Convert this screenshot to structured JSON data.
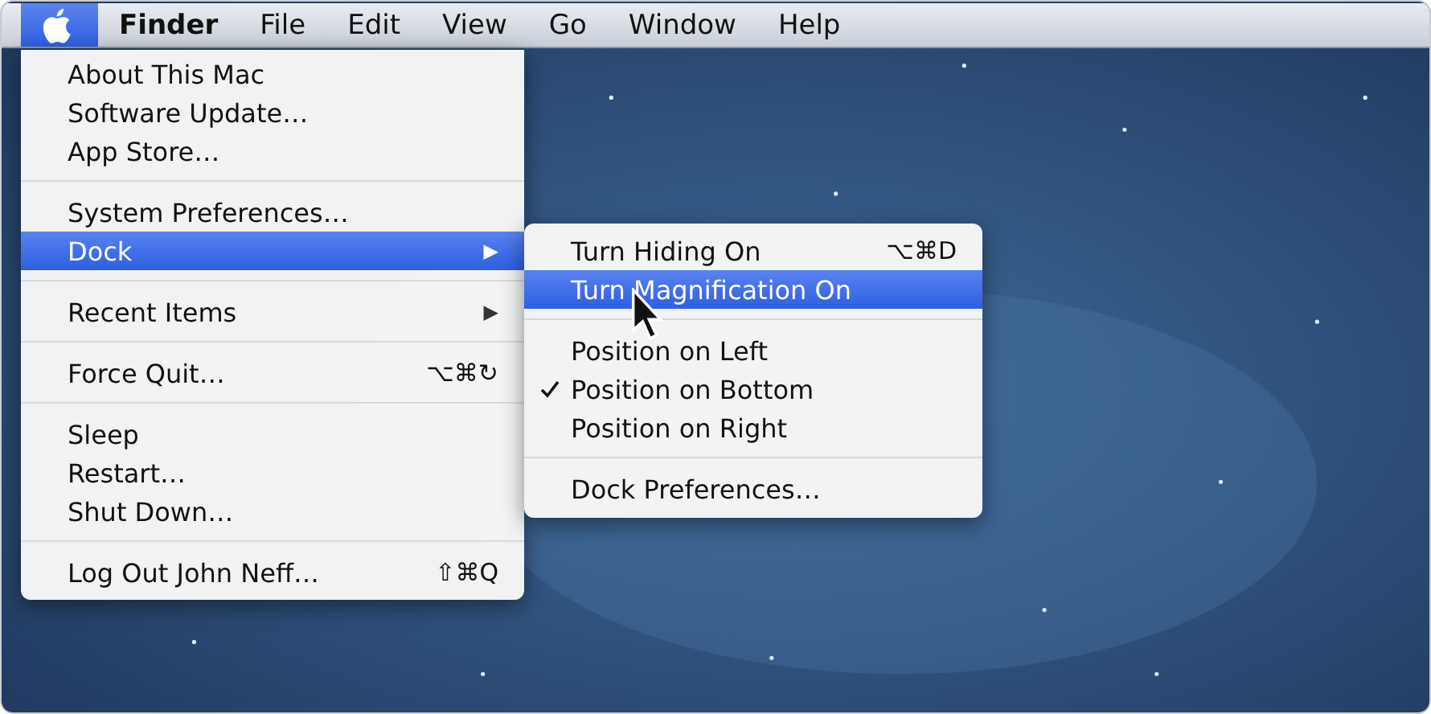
{
  "menu_bar": {
    "items": [
      {
        "kind": "apple",
        "selected": true
      },
      {
        "kind": "app",
        "label": "Finder",
        "selected": false
      },
      {
        "kind": "menu",
        "label": "File",
        "selected": false
      },
      {
        "kind": "menu",
        "label": "Edit",
        "selected": false
      },
      {
        "kind": "menu",
        "label": "View",
        "selected": false
      },
      {
        "kind": "menu",
        "label": "Go",
        "selected": false
      },
      {
        "kind": "menu",
        "label": "Window",
        "selected": false
      },
      {
        "kind": "menu",
        "label": "Help",
        "selected": false
      }
    ]
  },
  "apple_menu": {
    "items": [
      {
        "kind": "item",
        "label": "About This Mac",
        "selected": false
      },
      {
        "kind": "item",
        "label": "Software Update…",
        "selected": false
      },
      {
        "kind": "item",
        "label": "App Store…",
        "selected": false
      },
      {
        "kind": "separator"
      },
      {
        "kind": "item",
        "label": "System Preferences…",
        "selected": false
      },
      {
        "kind": "submenu",
        "label": "Dock",
        "arrow": "▶",
        "selected": true
      },
      {
        "kind": "separator"
      },
      {
        "kind": "submenu",
        "label": "Recent Items",
        "arrow": "▶",
        "selected": false
      },
      {
        "kind": "separator"
      },
      {
        "kind": "item",
        "label": "Force Quit…",
        "shortcut": "⌥⌘↻",
        "selected": false
      },
      {
        "kind": "separator"
      },
      {
        "kind": "item",
        "label": "Sleep",
        "selected": false
      },
      {
        "kind": "item",
        "label": "Restart…",
        "selected": false
      },
      {
        "kind": "item",
        "label": "Shut Down…",
        "selected": false
      },
      {
        "kind": "separator"
      },
      {
        "kind": "item",
        "label": "Log Out John Neff…",
        "shortcut": "⇧⌘Q",
        "selected": false
      }
    ]
  },
  "dock_submenu": {
    "items": [
      {
        "kind": "item",
        "label": "Turn Hiding On",
        "shortcut": "⌥⌘D",
        "selected": false,
        "checked": false
      },
      {
        "kind": "item",
        "label": "Turn Magnification On",
        "selected": true,
        "checked": false
      },
      {
        "kind": "separator"
      },
      {
        "kind": "item",
        "label": "Position on Left",
        "selected": false,
        "checked": false
      },
      {
        "kind": "item",
        "label": "Position on Bottom",
        "selected": false,
        "checked": true
      },
      {
        "kind": "item",
        "label": "Position on Right",
        "selected": false,
        "checked": false
      },
      {
        "kind": "separator"
      },
      {
        "kind": "item",
        "label": "Dock Preferences…",
        "selected": false,
        "checked": false
      }
    ]
  }
}
